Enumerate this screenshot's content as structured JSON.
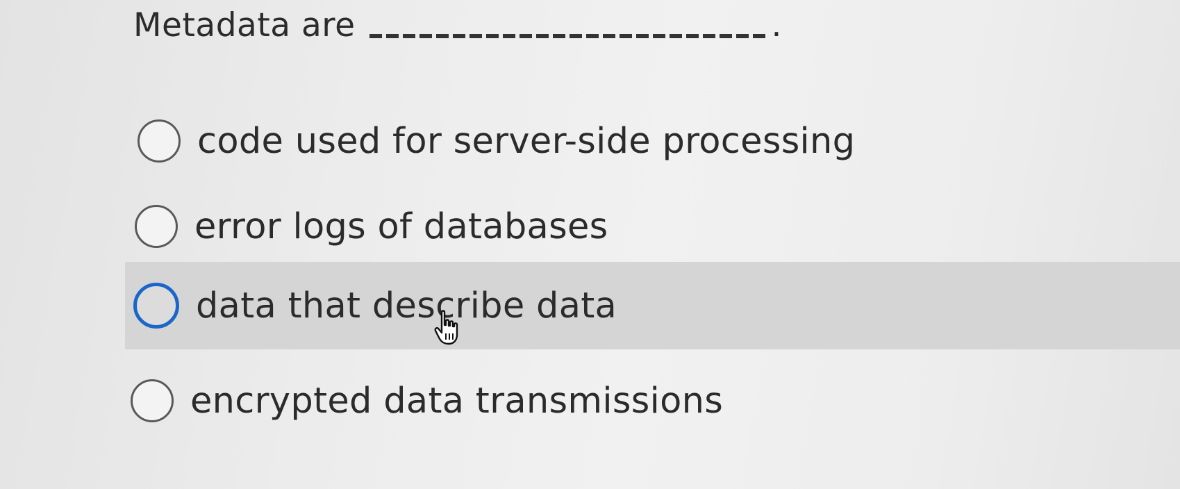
{
  "question": {
    "text": "Metadata are",
    "period": "."
  },
  "options": [
    {
      "label": "code used for server-side processing",
      "highlighted": false
    },
    {
      "label": "error logs of databases",
      "highlighted": false
    },
    {
      "label": "data that describe data",
      "highlighted": true
    },
    {
      "label": "encrypted data transmissions",
      "highlighted": false
    }
  ],
  "colors": {
    "highlight_bg": "#d5d5d5",
    "radio_focus_border": "#1a66c9",
    "text": "#2b2b2b"
  },
  "icons": {
    "cursor": "hand-pointer-icon"
  }
}
